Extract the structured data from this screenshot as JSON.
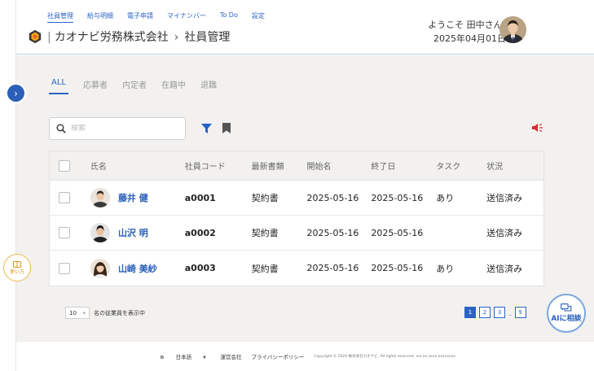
{
  "header": {
    "nav": [
      "社員管理",
      "給与明細",
      "電子申請",
      "マイナンバー",
      "To Do",
      "設定"
    ],
    "company_name": "カオナビ労務株式会社",
    "page_title": "社員管理",
    "welcome": "ようこそ 田中さん!",
    "date": "2025年04月01日"
  },
  "tabs": [
    "ALL",
    "応募者",
    "内定者",
    "在籍中",
    "退職"
  ],
  "search": {
    "placeholder": "検索"
  },
  "table": {
    "columns": [
      "氏名",
      "社員コード",
      "最新書類",
      "開始名",
      "終了日",
      "タスク",
      "状況"
    ],
    "rows": [
      {
        "name": "藤井 健",
        "code": "a0001",
        "doc": "契約書",
        "start": "2025-05-16",
        "end": "2025-05-16",
        "task": "あり",
        "status": "送信済み"
      },
      {
        "name": "山沢 明",
        "code": "a0002",
        "doc": "契約書",
        "start": "2025-05-16",
        "end": "2025-05-16",
        "task": "",
        "status": "送信済み"
      },
      {
        "name": "山崎 美紗",
        "code": "a0003",
        "doc": "契約書",
        "start": "2025-05-16",
        "end": "2025-05-16",
        "task": "あり",
        "status": "送信済み"
      }
    ]
  },
  "per_page": {
    "value": "10",
    "label": "名の従業員を表示中"
  },
  "pagination": {
    "pages": [
      "1",
      "2",
      "3"
    ],
    "last_page": "9",
    "current": "1"
  },
  "ai_button": {
    "label": "AIに相談"
  },
  "usage_button": {
    "label": "使い方"
  },
  "footer": {
    "language": "日本語",
    "company": "運営会社",
    "privacy": "プライバシーポリシー",
    "copyright": "Copyright © 2024 株式会社カオナビ, All rights reserved. ver.xx.xxxx.xxxxxxxx"
  },
  "colors": {
    "accent": "#2b63c6",
    "alert": "#d62d2d",
    "usage": "#f0b84a"
  }
}
